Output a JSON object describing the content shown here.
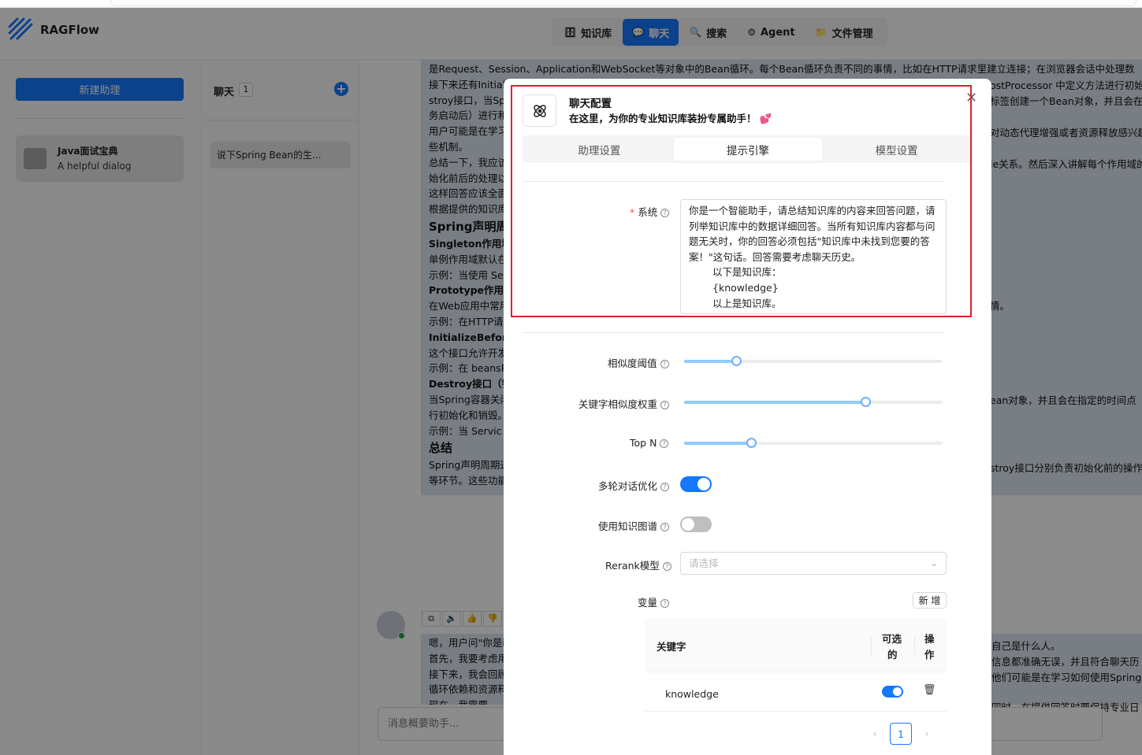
{
  "app": {
    "name": "RAGFlow",
    "nav": [
      {
        "label": "知识库",
        "icon": "database-icon",
        "active": false
      },
      {
        "label": "聊天",
        "icon": "chat-bubble-icon",
        "active": true
      },
      {
        "label": "搜索",
        "icon": "search-icon",
        "active": false
      },
      {
        "label": "Agent",
        "icon": "agent-graph-icon",
        "active": false
      },
      {
        "label": "文件管理",
        "icon": "folder-icon",
        "active": false
      }
    ]
  },
  "sidebar": {
    "new_assistant_label": "新建助理",
    "assistants": [
      {
        "name": "Java面试宝典",
        "description": "A helpful dialog"
      }
    ]
  },
  "conversations": {
    "title": "聊天",
    "count": "1",
    "items": [
      "说下Spring Bean的生..."
    ]
  },
  "chat": {
    "answer_lines": [
      {
        "style": "p",
        "text": "是Request、Session、Application和WebSocket等对象中的Bean循环。每个Bean循环负责不同的事情，比如在HTTP请求里建立连接；在浏览器会话中处理数据与"
      },
      {
        "style": "p",
        "text": "接下来还有Initial"
      },
      {
        "style": "p",
        "text": "stroy接口，当Sp"
      },
      {
        "style": "p",
        "text": "务启动后）进行和"
      },
      {
        "style": "p",
        "text": "用户可能是在学习"
      },
      {
        "style": "p",
        "text": "些机制。"
      },
      {
        "style": "p",
        "text": "总结一下，我应该"
      },
      {
        "style": "p",
        "text": "始化前后的处理以"
      },
      {
        "style": "p",
        "text": "这样回答应该全面"
      },
      {
        "style": "p",
        "text": "根据提供的知识库"
      },
      {
        "style": "h3",
        "text": "Spring声明周"
      },
      {
        "style": "h4",
        "text": "Singleton作用域"
      },
      {
        "style": "p",
        "text": "单例作用域默认在"
      },
      {
        "style": "p",
        "text": "示例：当使用 Ser"
      },
      {
        "style": "h4",
        "text": "Prototype作用域"
      },
      {
        "style": "p",
        "text": "在Web应用中常用"
      },
      {
        "style": "p",
        "text": "示例：在HTTP请"
      },
      {
        "style": "h4",
        "text": "InitializeBeforeI"
      },
      {
        "style": "p",
        "text": "这个接口允许开发"
      },
      {
        "style": "p",
        "text": "示例：在 beansP"
      },
      {
        "style": "h4",
        "text": "Destroy接口（销"
      },
      {
        "style": "p",
        "text": "当Spring容器关闭"
      },
      {
        "style": "p",
        "text": "行初始化和销毁。"
      },
      {
        "style": "p",
        "text": "示例：当 Servic"
      },
      {
        "style": "h3",
        "text": "总结"
      },
      {
        "style": "p",
        "text": "Spring声明周期通"
      },
      {
        "style": "p",
        "text": "等环节。这些功能"
      }
    ],
    "right_fragments": [
      "ostProcessor 中定义方法进行初始",
      "标签创建一个Bean对象，并且会在指",
      "对动态代理增强或者资源释放感兴趣",
      "le关系。然后深入讲解每个作用域的",
      "情。",
      "ean对象，并且会在指定的时间点",
      "stroy接口分别负责初始化前的操作"
    ],
    "message_tools": [
      "copy-icon",
      "speaker-icon",
      "thumbs-up-icon",
      "thumbs-down-icon"
    ],
    "second_answer_lines": [
      "嗯，用户问\"你是i",
      "首先，我要考虑用",
      "接下来，我会回顾",
      "循环依赖和资源释",
      "现在，我需要..."
    ],
    "second_right_fragments": [
      "自己是什么人。",
      "信息都准确无误，并且符合聊天历",
      "他们可能是在学习如何使用Spring",
      "同时，在提供回答时要保持专业日"
    ],
    "input_placeholder": "消息概要助手..."
  },
  "modal": {
    "title": "聊天配置",
    "subtitle": "在这里，为你的专业知识库装扮专属助手！ 💕",
    "tabs": [
      {
        "label": "助理设置",
        "active": false
      },
      {
        "label": "提示引擎",
        "active": true
      },
      {
        "label": "模型设置",
        "active": false
      }
    ],
    "system_label": "系统",
    "system_prompt_lines": [
      "你是一个智能助手，请总结知识库的内容来回答问题，请",
      "列举知识库中的数据详细回答。当所有知识库内容都与问",
      "题无关时，你的回答必须包括\"知识库中未找到您要的答",
      "案！\"这句话。回答需要考虑聊天历史。"
    ],
    "system_prompt_indent_lines": [
      "以下是知识库：",
      "{knowledge}",
      "以上是知识库。"
    ],
    "similarity_label": "相似度阈值",
    "similarity_value": 0.2,
    "keyword_weight_label": "关键字相似度权重",
    "keyword_weight_value": 0.7,
    "topn_label": "Top N",
    "topn_value_fraction": 0.26,
    "multiturn_label": "多轮对话优化",
    "multiturn_on": true,
    "kg_label": "使用知识图谱",
    "kg_on": false,
    "rerank_label": "Rerank模型",
    "rerank_placeholder": "请选择",
    "variables_label": "变量",
    "add_label": "新 增",
    "table": {
      "col_keyword": "关键字",
      "col_optional_1": "可选",
      "col_optional_2": "的",
      "col_action_1": "操",
      "col_action_2": "作",
      "rows": [
        {
          "keyword": "knowledge",
          "optional": true
        }
      ]
    },
    "page": "1"
  },
  "colors": {
    "primary": "#1677ff",
    "answer_bg": "#dbe5ef",
    "highlight_border": "#d9232d"
  }
}
